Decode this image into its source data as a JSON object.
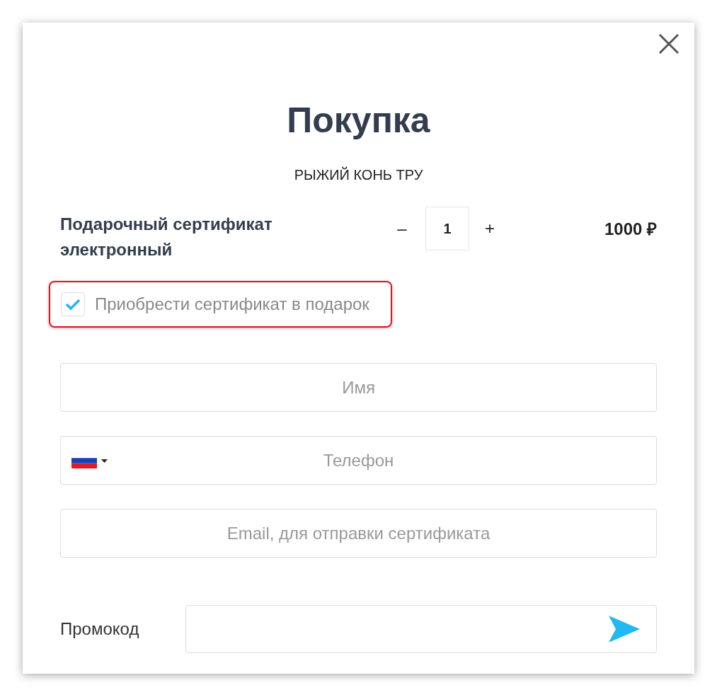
{
  "title": "Покупка",
  "subtitle": "РЫЖИЙ КОНЬ ТРУ",
  "product": {
    "name": "Подарочный сертификат электронный",
    "minus": "–",
    "quantity": "1",
    "plus": "+",
    "price": "1000 ₽"
  },
  "gift": {
    "label": "Приобрести сертификат в подарок",
    "checked": true,
    "highlighted": true
  },
  "fields": [
    {
      "kind": "text",
      "placeholder": "Имя"
    },
    {
      "kind": "phone",
      "placeholder": "Телефон"
    },
    {
      "kind": "text",
      "placeholder": "Email, для отправки сертификата"
    }
  ],
  "promo": {
    "label": "Промокод"
  }
}
